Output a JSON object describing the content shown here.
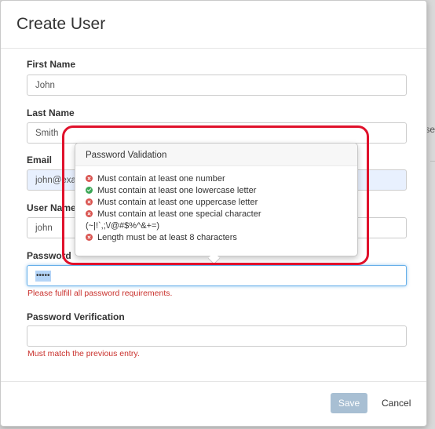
{
  "dialog": {
    "title": "Create User",
    "fields": {
      "first_name": {
        "label": "First Name",
        "value": "John"
      },
      "last_name": {
        "label": "Last Name",
        "value": "Smith"
      },
      "email": {
        "label": "Email",
        "value": "john@exa"
      },
      "user_name": {
        "label": "User Name",
        "value": "john"
      },
      "password": {
        "label": "Password",
        "value": "•••••",
        "error": "Please fulfill all password requirements."
      },
      "password_verification": {
        "label": "Password Verification",
        "value": "",
        "error": "Must match the previous entry."
      }
    },
    "footer": {
      "save_label": "Save",
      "cancel_label": "Cancel"
    }
  },
  "validation_popover": {
    "title": "Password Validation",
    "rules": [
      {
        "text": "Must contain at least one number",
        "status": "fail"
      },
      {
        "text": "Must contain at least one lowercase letter",
        "status": "pass"
      },
      {
        "text": "Must contain at least one uppercase letter",
        "status": "fail"
      },
      {
        "text": "Must contain at least one special character",
        "status": "fail"
      },
      {
        "text": "(~|!`,;\\/@#$%^&+=)",
        "status": "note"
      },
      {
        "text": "Length must be at least 8 characters",
        "status": "fail"
      }
    ]
  },
  "background": {
    "right_edge_text": "se"
  },
  "colors": {
    "error": "#c9302c",
    "rule_fail": "#d9534f",
    "rule_pass": "#3aa655",
    "save_button": "#a8bfd3",
    "highlight": "#e0112b",
    "focus_border": "#66afe9"
  },
  "icons": {
    "rule_fail": "x-circle-icon",
    "rule_pass": "check-circle-icon"
  }
}
